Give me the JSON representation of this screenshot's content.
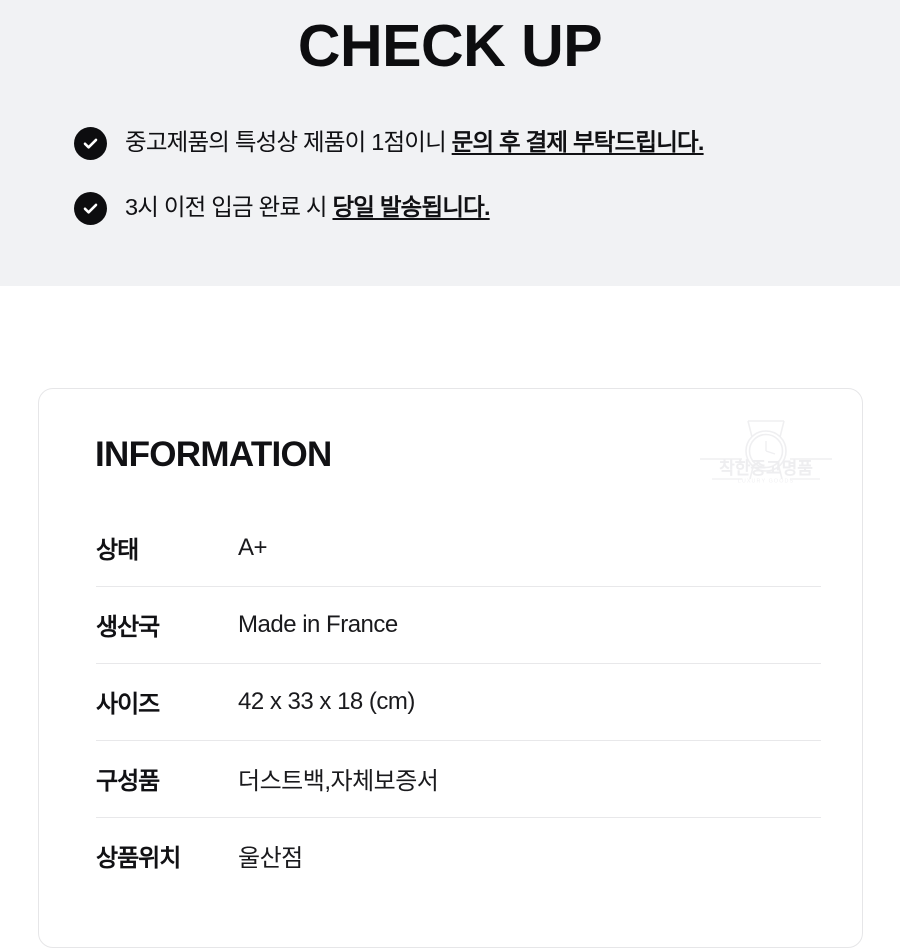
{
  "banner": {
    "title": "CHECK UP",
    "background_color": "#f1f2f4",
    "bullets": [
      {
        "icon": "check-circle-icon",
        "text_plain": "중고제품의 특성상 제품이 1점이니 ",
        "text_emphasis": "문의 후 결제 부탁드립니다."
      },
      {
        "icon": "check-circle-icon",
        "text_plain": "3시 이전 입금 완료 시 ",
        "text_emphasis": "당일 발송됩니다."
      }
    ]
  },
  "info_card": {
    "title": "INFORMATION",
    "logo": {
      "name": "chakhan-jungo-myeongpum-watermark-logo",
      "brand_kr": "착한중고명품",
      "brand_en": "LUXURY GOODS"
    },
    "rows": [
      {
        "label": "상태",
        "value": "A+"
      },
      {
        "label": "생산국",
        "value": "Made in France"
      },
      {
        "label": "사이즈",
        "value": "42 x 33 x 18 (cm)"
      },
      {
        "label": "구성품",
        "value": "더스트백,자체보증서"
      },
      {
        "label": "상품위치",
        "value": "울산점"
      }
    ]
  },
  "colors": {
    "text": "#111114",
    "banner_bg": "#f1f2f4",
    "card_bg": "#ffffff",
    "card_border": "#e6e6e8",
    "divider": "#e8e8ea",
    "icon_fill": "#0d0d0f",
    "watermark": "#f0f0f2"
  }
}
